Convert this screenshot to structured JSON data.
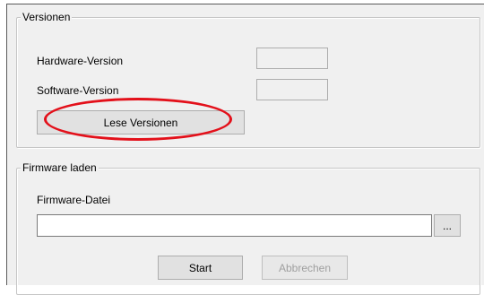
{
  "versions_group": {
    "title": "Versionen",
    "hardware_label": "Hardware-Version",
    "hardware_value": "",
    "software_label": "Software-Version",
    "software_value": "",
    "read_button": "Lese Versionen"
  },
  "firmware_group": {
    "title": "Firmware laden",
    "file_label": "Firmware-Datei",
    "file_value": "",
    "browse_button": "...",
    "start_button": "Start",
    "cancel_button": "Abbrechen"
  },
  "annotation": {
    "color": "#e3101a"
  }
}
